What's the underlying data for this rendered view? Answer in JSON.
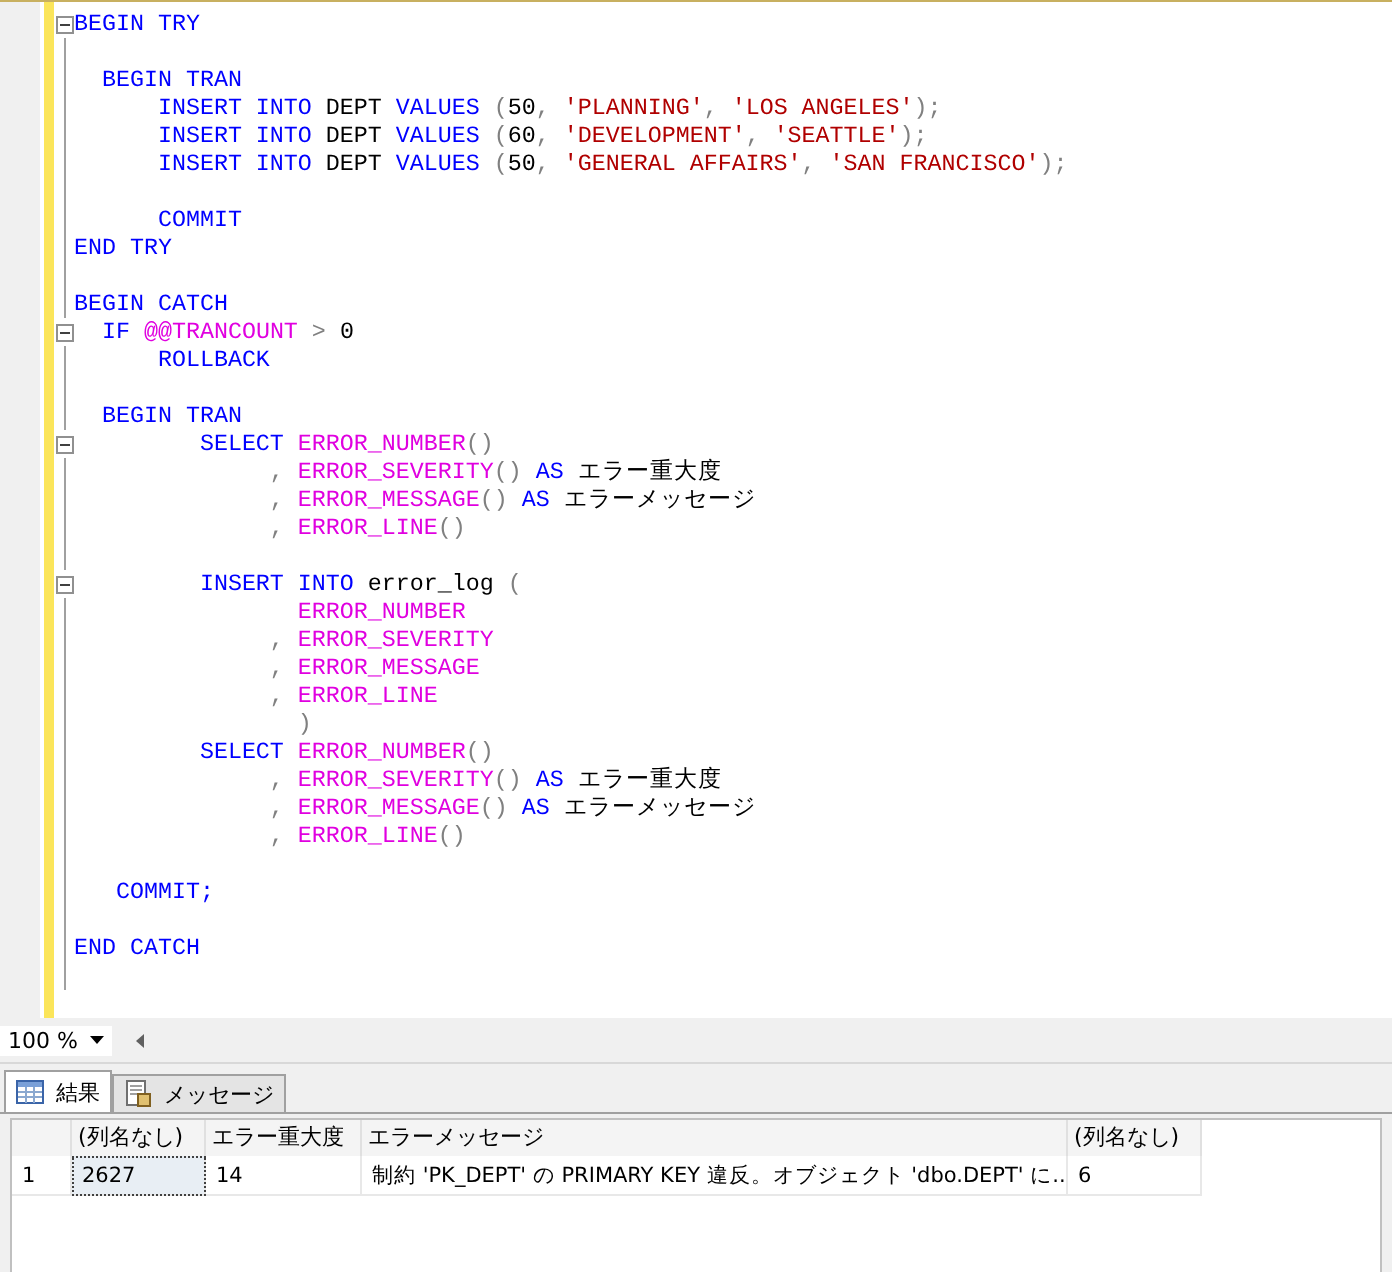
{
  "editor": {
    "lines": [
      {
        "kind": "code",
        "collapsible": true,
        "tokens": [
          {
            "kind": "keyword",
            "text": "BEGIN TRY"
          }
        ]
      },
      {
        "kind": "blank",
        "collapsible": false
      },
      {
        "kind": "code",
        "collapsible": false,
        "tokens": [
          {
            "kind": "keyword",
            "text": "  BEGIN TRAN"
          }
        ]
      },
      {
        "kind": "code",
        "collapsible": false,
        "tokens": [
          {
            "kind": "keyword",
            "text": "      INSERT INTO"
          },
          {
            "kind": "plain",
            "text": " DEPT "
          },
          {
            "kind": "keyword",
            "text": "VALUES "
          },
          {
            "kind": "operator",
            "text": "("
          },
          {
            "kind": "plain",
            "text": "50"
          },
          {
            "kind": "operator",
            "text": ", "
          },
          {
            "kind": "string",
            "text": "'PLANNING'"
          },
          {
            "kind": "operator",
            "text": ", "
          },
          {
            "kind": "string",
            "text": "'LOS ANGELES'"
          },
          {
            "kind": "operator",
            "text": ");"
          }
        ]
      },
      {
        "kind": "code",
        "collapsible": false,
        "tokens": [
          {
            "kind": "keyword",
            "text": "      INSERT INTO"
          },
          {
            "kind": "plain",
            "text": " DEPT "
          },
          {
            "kind": "keyword",
            "text": "VALUES "
          },
          {
            "kind": "operator",
            "text": "("
          },
          {
            "kind": "plain",
            "text": "60"
          },
          {
            "kind": "operator",
            "text": ", "
          },
          {
            "kind": "string",
            "text": "'DEVELOPMENT'"
          },
          {
            "kind": "operator",
            "text": ", "
          },
          {
            "kind": "string",
            "text": "'SEATTLE'"
          },
          {
            "kind": "operator",
            "text": ");"
          }
        ]
      },
      {
        "kind": "code",
        "collapsible": false,
        "tokens": [
          {
            "kind": "keyword",
            "text": "      INSERT INTO"
          },
          {
            "kind": "plain",
            "text": " DEPT "
          },
          {
            "kind": "keyword",
            "text": "VALUES "
          },
          {
            "kind": "operator",
            "text": "("
          },
          {
            "kind": "plain",
            "text": "50"
          },
          {
            "kind": "operator",
            "text": ", "
          },
          {
            "kind": "string",
            "text": "'GENERAL AFFAIRS'"
          },
          {
            "kind": "operator",
            "text": ", "
          },
          {
            "kind": "string",
            "text": "'SAN FRANCISCO'"
          },
          {
            "kind": "operator",
            "text": ");"
          }
        ]
      },
      {
        "kind": "blank",
        "collapsible": false
      },
      {
        "kind": "code",
        "collapsible": false,
        "tokens": [
          {
            "kind": "keyword",
            "text": "      COMMIT"
          }
        ]
      },
      {
        "kind": "code",
        "collapsible": false,
        "tokens": [
          {
            "kind": "keyword",
            "text": "END TRY"
          }
        ]
      },
      {
        "kind": "blank",
        "collapsible": false
      },
      {
        "kind": "code",
        "collapsible": false,
        "tokens": [
          {
            "kind": "keyword",
            "text": "BEGIN CATCH"
          }
        ]
      },
      {
        "kind": "code",
        "collapsible": true,
        "tokens": [
          {
            "kind": "keyword",
            "text": "  IF "
          },
          {
            "kind": "function",
            "text": "@@TRANCOUNT"
          },
          {
            "kind": "operator",
            "text": " > "
          },
          {
            "kind": "plain",
            "text": "0"
          }
        ]
      },
      {
        "kind": "code",
        "collapsible": false,
        "tokens": [
          {
            "kind": "keyword",
            "text": "      ROLLBACK"
          }
        ]
      },
      {
        "kind": "blank",
        "collapsible": false
      },
      {
        "kind": "code",
        "collapsible": false,
        "tokens": [
          {
            "kind": "keyword",
            "text": "  BEGIN TRAN"
          }
        ]
      },
      {
        "kind": "code",
        "collapsible": true,
        "tokens": [
          {
            "kind": "keyword",
            "text": "         SELECT "
          },
          {
            "kind": "function",
            "text": "ERROR_NUMBER"
          },
          {
            "kind": "operator",
            "text": "()"
          }
        ]
      },
      {
        "kind": "code",
        "collapsible": false,
        "tokens": [
          {
            "kind": "operator",
            "text": "              , "
          },
          {
            "kind": "function",
            "text": "ERROR_SEVERITY"
          },
          {
            "kind": "operator",
            "text": "() "
          },
          {
            "kind": "keyword",
            "text": "AS "
          },
          {
            "kind": "plain",
            "text": "エラー重大度"
          }
        ]
      },
      {
        "kind": "code",
        "collapsible": false,
        "tokens": [
          {
            "kind": "operator",
            "text": "              , "
          },
          {
            "kind": "function",
            "text": "ERROR_MESSAGE"
          },
          {
            "kind": "operator",
            "text": "() "
          },
          {
            "kind": "keyword",
            "text": "AS "
          },
          {
            "kind": "plain",
            "text": "エラーメッセージ"
          }
        ]
      },
      {
        "kind": "code",
        "collapsible": false,
        "tokens": [
          {
            "kind": "operator",
            "text": "              , "
          },
          {
            "kind": "function",
            "text": "ERROR_LINE"
          },
          {
            "kind": "operator",
            "text": "()"
          }
        ]
      },
      {
        "kind": "blank",
        "collapsible": false
      },
      {
        "kind": "code",
        "collapsible": true,
        "tokens": [
          {
            "kind": "keyword",
            "text": "         INSERT INTO "
          },
          {
            "kind": "plain",
            "text": "error_log "
          },
          {
            "kind": "operator",
            "text": "("
          }
        ]
      },
      {
        "kind": "code",
        "collapsible": false,
        "tokens": [
          {
            "kind": "function",
            "text": "                ERROR_NUMBER"
          }
        ]
      },
      {
        "kind": "code",
        "collapsible": false,
        "tokens": [
          {
            "kind": "operator",
            "text": "              , "
          },
          {
            "kind": "function",
            "text": "ERROR_SEVERITY"
          }
        ]
      },
      {
        "kind": "code",
        "collapsible": false,
        "tokens": [
          {
            "kind": "operator",
            "text": "              , "
          },
          {
            "kind": "function",
            "text": "ERROR_MESSAGE"
          }
        ]
      },
      {
        "kind": "code",
        "collapsible": false,
        "tokens": [
          {
            "kind": "operator",
            "text": "              , "
          },
          {
            "kind": "function",
            "text": "ERROR_LINE"
          }
        ]
      },
      {
        "kind": "code",
        "collapsible": false,
        "tokens": [
          {
            "kind": "operator",
            "text": "                )"
          }
        ]
      },
      {
        "kind": "code",
        "collapsible": false,
        "tokens": [
          {
            "kind": "keyword",
            "text": "         SELECT "
          },
          {
            "kind": "function",
            "text": "ERROR_NUMBER"
          },
          {
            "kind": "operator",
            "text": "()"
          }
        ]
      },
      {
        "kind": "code",
        "collapsible": false,
        "tokens": [
          {
            "kind": "operator",
            "text": "              , "
          },
          {
            "kind": "function",
            "text": "ERROR_SEVERITY"
          },
          {
            "kind": "operator",
            "text": "() "
          },
          {
            "kind": "keyword",
            "text": "AS "
          },
          {
            "kind": "plain",
            "text": "エラー重大度"
          }
        ]
      },
      {
        "kind": "code",
        "collapsible": false,
        "tokens": [
          {
            "kind": "operator",
            "text": "              , "
          },
          {
            "kind": "function",
            "text": "ERROR_MESSAGE"
          },
          {
            "kind": "operator",
            "text": "() "
          },
          {
            "kind": "keyword",
            "text": "AS "
          },
          {
            "kind": "plain",
            "text": "エラーメッセージ"
          }
        ]
      },
      {
        "kind": "code",
        "collapsible": false,
        "tokens": [
          {
            "kind": "operator",
            "text": "              , "
          },
          {
            "kind": "function",
            "text": "ERROR_LINE"
          },
          {
            "kind": "operator",
            "text": "()"
          }
        ]
      },
      {
        "kind": "blank",
        "collapsible": false
      },
      {
        "kind": "code",
        "collapsible": false,
        "tokens": [
          {
            "kind": "keyword",
            "text": "   COMMIT;"
          }
        ]
      },
      {
        "kind": "blank",
        "collapsible": false
      },
      {
        "kind": "code",
        "collapsible": false,
        "tokens": [
          {
            "kind": "keyword",
            "text": "END CATCH"
          }
        ]
      },
      {
        "kind": "blank",
        "collapsible": false
      }
    ]
  },
  "zoom": {
    "value": "100 %"
  },
  "tabs": [
    {
      "label": "結果",
      "selected": true
    },
    {
      "label": "メッセージ",
      "selected": false
    }
  ],
  "results": {
    "columns": [
      "(列名なし)",
      "エラー重大度",
      "エラーメッセージ",
      "(列名なし)"
    ],
    "rows": [
      {
        "number": "1",
        "cells": [
          {
            "text": "2627",
            "focused": true
          },
          {
            "text": "14",
            "focused": false
          },
          {
            "text": "制約 'PK_DEPT' の PRIMARY KEY 違反。オブジェクト 'dbo.DEPT' に...",
            "focused": false
          },
          {
            "text": "6",
            "focused": false
          }
        ]
      }
    ]
  }
}
